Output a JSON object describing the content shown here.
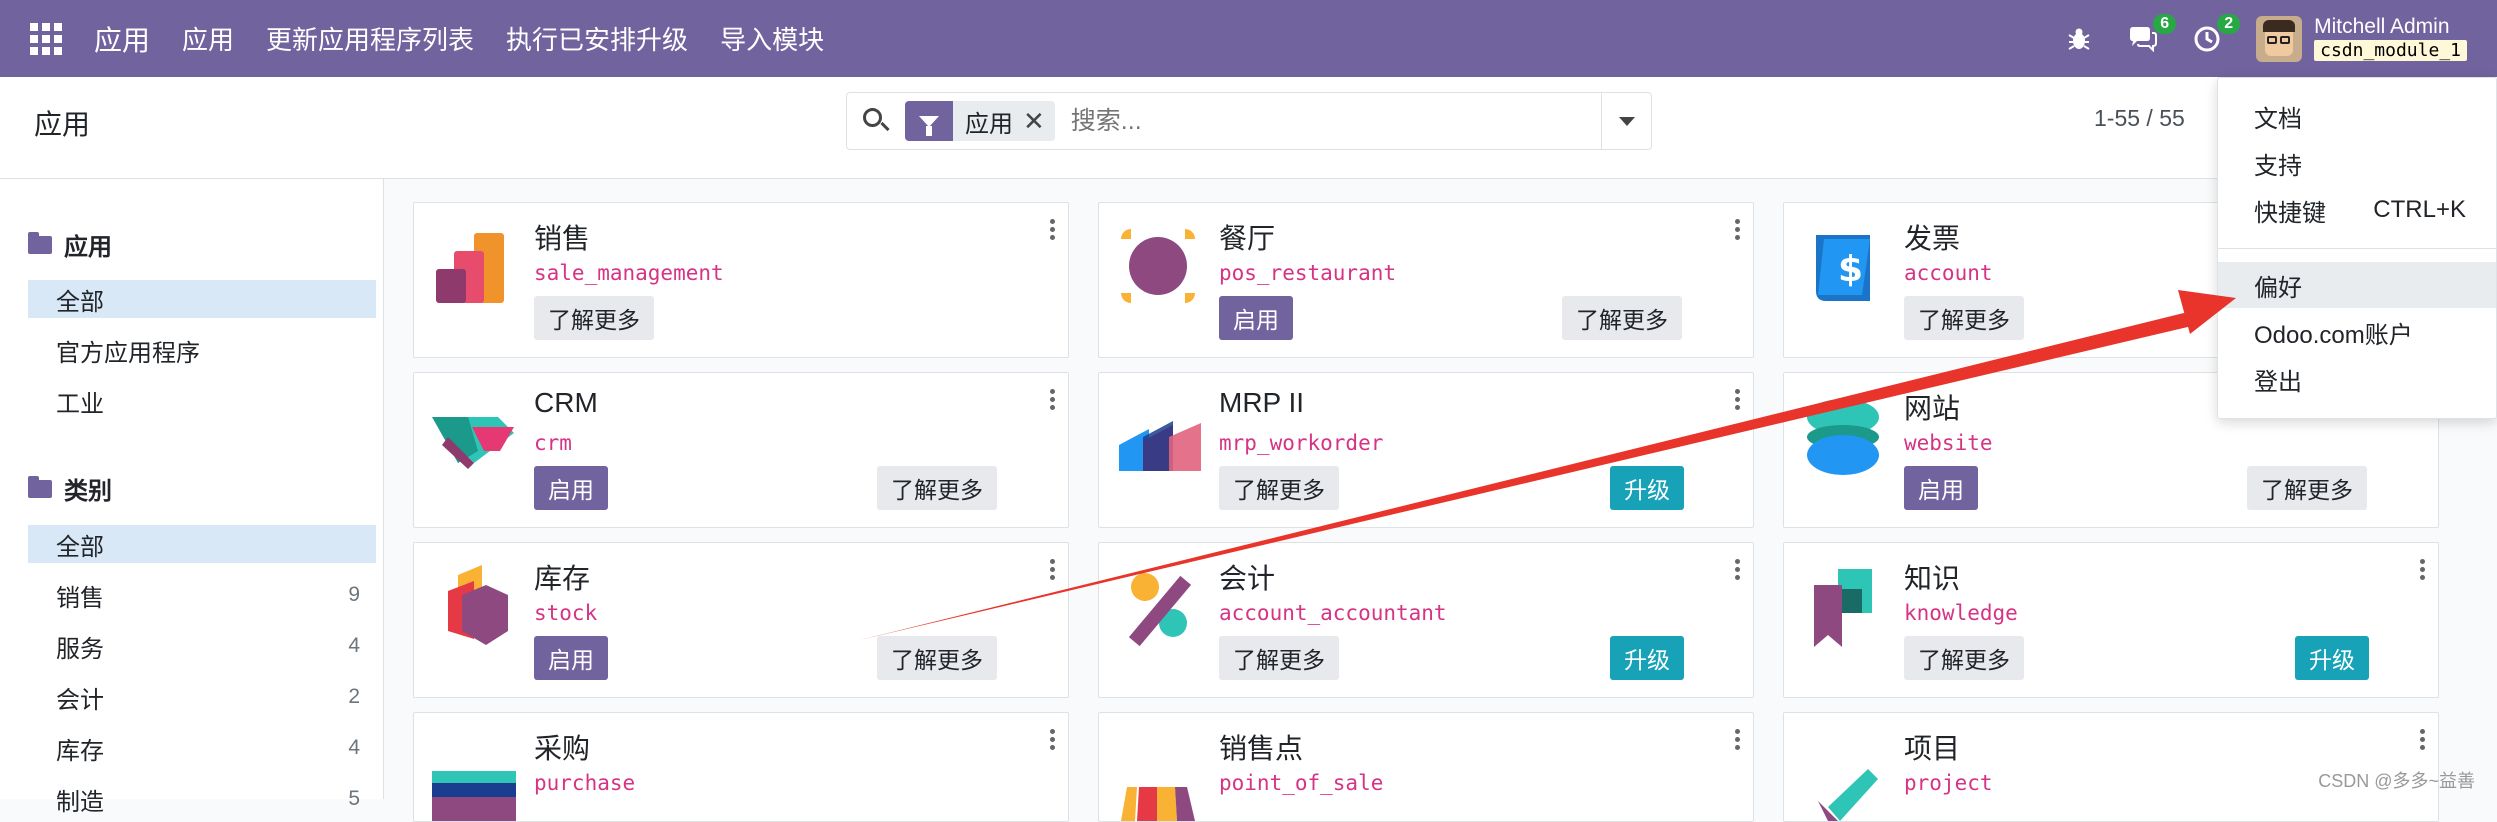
{
  "navbar": {
    "brand": "应用",
    "menu": [
      "应用",
      "更新应用程序列表",
      "执行已安排升级",
      "导入模块"
    ],
    "chat_count": "6",
    "activity_count": "2",
    "user_name": "Mitchell Admin",
    "db_name": "csdn_module_1"
  },
  "control": {
    "breadcrumb": "应用",
    "facet_label": "应用",
    "search_placeholder": "搜索...",
    "pager": "1-55 / 55"
  },
  "sidebar": {
    "apps_header": "应用",
    "apps_items": [
      "全部",
      "官方应用程序",
      "工业"
    ],
    "categories_header": "类别",
    "categories": [
      {
        "label": "全部",
        "count": ""
      },
      {
        "label": "销售",
        "count": "9"
      },
      {
        "label": "服务",
        "count": "4"
      },
      {
        "label": "会计",
        "count": "2"
      },
      {
        "label": "库存",
        "count": "4"
      },
      {
        "label": "制造",
        "count": "5"
      }
    ]
  },
  "cards": [
    {
      "title": "销售",
      "tech": "sale_management",
      "primary": "",
      "learn": "了解更多",
      "upgrade": ""
    },
    {
      "title": "餐厅",
      "tech": "pos_restaurant",
      "primary": "启用",
      "learn": "了解更多",
      "upgrade": ""
    },
    {
      "title": "发票",
      "tech": "account",
      "primary": "",
      "learn": "了解更多",
      "upgrade": ""
    },
    {
      "title": "CRM",
      "tech": "crm",
      "primary": "启用",
      "learn": "了解更多",
      "upgrade": ""
    },
    {
      "title": "MRP II",
      "tech": "mrp_workorder",
      "primary": "",
      "learn": "了解更多",
      "upgrade": "升级"
    },
    {
      "title": "网站",
      "tech": "website",
      "primary": "启用",
      "learn": "了解更多",
      "upgrade": ""
    },
    {
      "title": "库存",
      "tech": "stock",
      "primary": "启用",
      "learn": "了解更多",
      "upgrade": ""
    },
    {
      "title": "会计",
      "tech": "account_accountant",
      "primary": "",
      "learn": "了解更多",
      "upgrade": "升级"
    },
    {
      "title": "知识",
      "tech": "knowledge",
      "primary": "",
      "learn": "了解更多",
      "upgrade": "升级"
    },
    {
      "title": "采购",
      "tech": "purchase"
    },
    {
      "title": "销售点",
      "tech": "point_of_sale"
    },
    {
      "title": "项目",
      "tech": "project"
    }
  ],
  "dropdown": {
    "items": [
      "文档",
      "支持",
      "快捷键",
      "偏好",
      "Odoo.com账户",
      "登出"
    ],
    "shortcut": "CTRL+K"
  },
  "watermark": "CSDN @多多~益善",
  "colors": {
    "brand": "#71639e",
    "upgrade": "#17a2b8",
    "tech_name": "#d63384",
    "annotation_arrow": "#e8342a"
  }
}
